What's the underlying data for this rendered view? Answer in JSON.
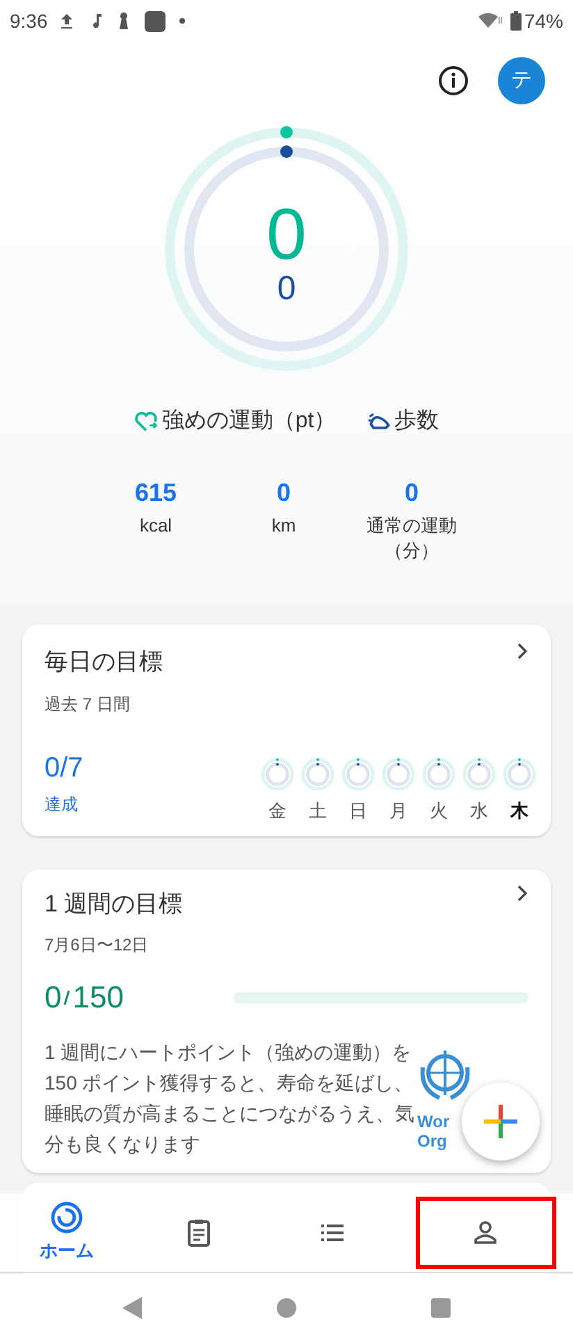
{
  "status_bar": {
    "time": "9:36",
    "battery": "74%"
  },
  "header": {
    "avatar_letter": "テ"
  },
  "ring": {
    "heart_points": "0",
    "steps": "0"
  },
  "legend": [
    {
      "kind": "heart",
      "label": "強めの運動（pt）"
    },
    {
      "kind": "steps",
      "label": "歩数"
    }
  ],
  "stats": [
    {
      "value": "615",
      "label": "kcal"
    },
    {
      "value": "0",
      "label": "km"
    },
    {
      "value": "0",
      "label": "通常の運動（分）"
    }
  ],
  "daily_goal": {
    "title": "毎日の目標",
    "subtitle": "過去 7 日間",
    "count": "0/7",
    "count_label": "達成",
    "days": [
      {
        "label": "金",
        "today": false
      },
      {
        "label": "土",
        "today": false
      },
      {
        "label": "日",
        "today": false
      },
      {
        "label": "月",
        "today": false
      },
      {
        "label": "火",
        "today": false
      },
      {
        "label": "水",
        "today": false
      },
      {
        "label": "木",
        "today": true
      }
    ]
  },
  "weekly_goal": {
    "title": "1 週間の目標",
    "subtitle": "7月6日〜12日",
    "count": "0",
    "total": "150",
    "level": 0,
    "description": "1 週間にハートポイント（強めの運動）を 150 ポイント獲得すると、寿命を延ばし、睡眠の質が高まることにつながるうえ、気分も良くなります",
    "logo_lines": [
      "Wor",
      "Org"
    ]
  },
  "banner": {
    "kind": "card"
  },
  "bottom_nav": [
    {
      "kind": "home",
      "label": "ホーム",
      "selected": true,
      "highlighted": false
    },
    {
      "kind": "journal",
      "selected": false,
      "highlighted": false
    },
    {
      "kind": "browse",
      "selected": false,
      "highlighted": false
    },
    {
      "kind": "profile",
      "selected": false,
      "highlighted": true
    }
  ]
}
